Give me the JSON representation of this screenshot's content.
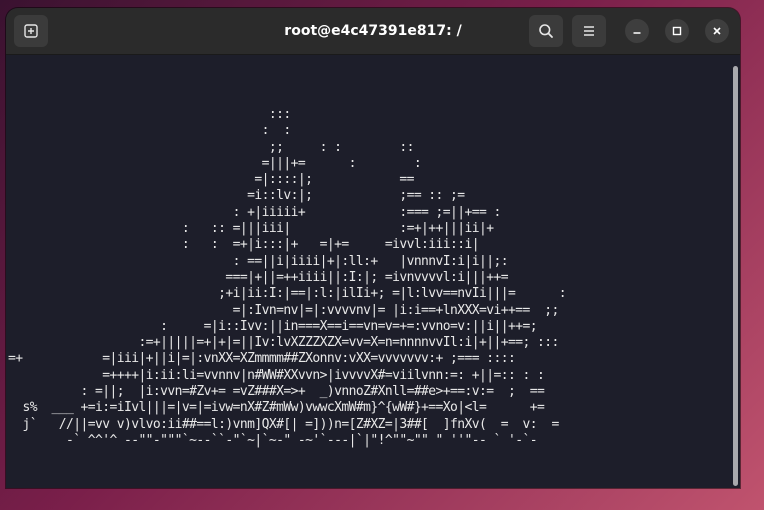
{
  "window": {
    "title": "root@e4c47391e817: /"
  },
  "titlebar": {
    "new_tab_icon": "new-tab-icon",
    "search_icon": "search-icon",
    "menu_icon": "hamburger-menu-icon",
    "minimize_icon": "minimize-icon",
    "maximize_icon": "maximize-icon",
    "close_icon": "close-icon"
  },
  "terminal": {
    "output": "                                    :::\n                                   :  :\n                                    ;;     : :        ::\n                                   =|||+=      :        :\n                                  =|::::|;            ==\n                                 =i::lv:|;            ;== :: ;=\n                               : +|iiiii+             :=== ;=||+== :\n                        :   :: =|||iii|               :=+|++|||ii|+\n                        :   :  =+|i:::|+   =|+=     =ivvl:iii::i|\n                               : ==||i|iiii|+|:ll:+   |vnnnvI:i|i||;:\n                              ===|+||=++iiii||:I:|; =ivnvvvvl:i|||++=\n                             ;+i|ii:I:|==|:l:|ilIi+; =|l:lvv==nvIi|||=      :\n                               =|:Ivn=nv|=|:vvvvnv|= |i:i==+lnXXX=vi++==  ;;\n                     :     =|i::Ivv:||in===X==i==vn=v=+=:vvno=v:||i||++=;\n                  :=+|||||=+|+|=||Iv:lvXZZZXZX=vv=X=n=nnnnvvIl:i|+||+==; :::\n=+           =|iii|+||i|=|:vnXX=XZmmmm##ZXonnv:vXX=vvvvvvv:+ ;=== ::::\n             =++++|i:ii:li=vvnnv|n#WW#XXvvn>|ivvvvX#=viilvnn:=: +||=:: : :\n          : =||;  |i:vvn=#Zv+= =vZ###X=>+  _)vnnoZ#Xnll=##e>+==:v:=  ;  ==\n  s%  ___ +=i:=iIvl|||=|v=|=ivw=nX#Z#mWw)vwwcXmW#m}^{wW#}+==Xo|<l=      +=\n  j`   //||=vv v)vlvo:ii##==l:)vnm]QX#[| =]))n=[Z#XZ=|3##[  ]fnXv(  =  v:  =\n        -` ^^'^ --\"\"-\"\"\"`~--``-\"`~|`~-\" -~'`---|`|\"!^\"\"~\"\" \" ''\"-- ` '-`-"
  }
}
